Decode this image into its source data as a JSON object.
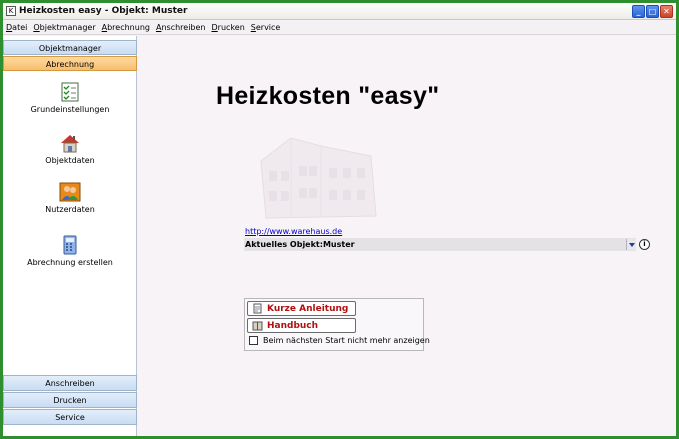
{
  "window": {
    "icon_label": "K",
    "title": "Heizkosten easy -  Objekt: Muster",
    "buttons": [
      "_",
      "□",
      "✕"
    ]
  },
  "menu": [
    "Datei",
    "Objektmanager",
    "Abrechnung",
    "Anschreiben",
    "Drucken",
    "Service"
  ],
  "sidebar": {
    "top_tabs": [
      {
        "label": "Objektmanager",
        "active": false
      },
      {
        "label": "Abrechnung",
        "active": true
      }
    ],
    "items": [
      {
        "label": "Grundeinstellungen",
        "icon": "checklist-icon"
      },
      {
        "label": "Objektdaten",
        "icon": "house-icon"
      },
      {
        "label": "Nutzerdaten",
        "icon": "users-icon"
      },
      {
        "label": "Abrechnung erstellen",
        "icon": "calculator-icon"
      }
    ],
    "bottom_tabs": [
      "Anschreiben",
      "Drucken",
      "Service"
    ]
  },
  "main": {
    "heading": "Heizkosten \"easy\"",
    "link": "http://www.warehaus.de",
    "object_label": "Aktuelles Objekt:Muster",
    "info_icon": "i",
    "help_buttons": [
      "Kurze Anleitung",
      "Handbuch"
    ],
    "checkbox_label": "Beim nächsten Start nicht mehr anzeigen",
    "checkbox_checked": false
  },
  "colors": {
    "frame_border": "#2f8f2f",
    "active_tab": "#f6be6c",
    "tab_blue": "#c8dcf3",
    "help_text": "#b01010",
    "link": "#0000cc"
  }
}
